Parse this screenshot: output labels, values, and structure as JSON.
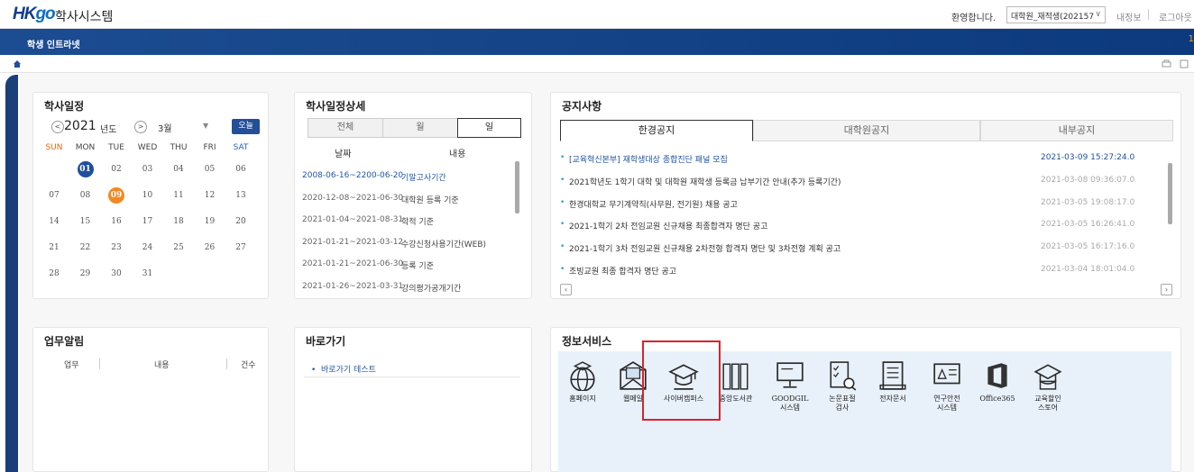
{
  "header": {
    "logo_main": "HK",
    "logo_accent": "go",
    "system_title": "학사시스템",
    "welcome": "환영합니다.",
    "user_select_value": "대학원_재적생(202157",
    "link_myinfo": "내정보",
    "link_logout": "로그아웃"
  },
  "navbar": {
    "title": "학생 인트라넷",
    "badge": "1"
  },
  "calendar": {
    "title": "학사일정",
    "year": "2021",
    "year_label": "년도",
    "month": "3월",
    "today_label": "오늘",
    "weekdays": [
      "SUN",
      "MON",
      "TUE",
      "WED",
      "THU",
      "FRI",
      "SAT"
    ],
    "weeks": [
      [
        "",
        "01",
        "02",
        "03",
        "04",
        "05",
        "06"
      ],
      [
        "07",
        "08",
        "09",
        "10",
        "11",
        "12",
        "13"
      ],
      [
        "14",
        "15",
        "16",
        "17",
        "18",
        "19",
        "20"
      ],
      [
        "21",
        "22",
        "23",
        "24",
        "25",
        "26",
        "27"
      ],
      [
        "28",
        "29",
        "30",
        "31",
        "",
        "",
        ""
      ]
    ],
    "selected_color": "#1f4f9e",
    "today_color": "#f08a24"
  },
  "schedule_detail": {
    "title": "학사일정상세",
    "tabs": [
      "전체",
      "월",
      "일"
    ],
    "col_date": "날짜",
    "col_content": "내용",
    "rows": [
      {
        "date": "2008-06-16~2200-06-20",
        "content": "기말고사기간"
      },
      {
        "date": "2020-12-08~2021-06-30",
        "content": "대학원 등록 기준"
      },
      {
        "date": "2021-01-04~2021-08-31",
        "content": "학적 기준"
      },
      {
        "date": "2021-01-21~2021-03-12",
        "content": "수강신청사용기간(WEB)"
      },
      {
        "date": "2021-01-21~2021-06-30",
        "content": "등록 기준"
      },
      {
        "date": "2021-01-26~2021-03-31",
        "content": "강의평가공개기간"
      }
    ]
  },
  "notices": {
    "title": "공지사항",
    "tabs": [
      "한경공지",
      "대학원공지",
      "내부공지"
    ],
    "rows": [
      {
        "title": "[교육혁신본부] 재학생대상 종합진단 패널 모집",
        "date": "2021-03-09 15:27:24.0"
      },
      {
        "title": "2021학년도 1학기 대학 및 대학원 재학생 등록금 납부기간 안내(추가 등록기간)",
        "date": "2021-03-08 09:36:07.0"
      },
      {
        "title": "한경대학교 무기계약직(사무원, 전기원) 채용 공고",
        "date": "2021-03-05 19:08:17.0"
      },
      {
        "title": " 2021-1학기 2차 전임교원 신규채용 최종합격자 명단 공고",
        "date": "2021-03-05 16:26:41.0"
      },
      {
        "title": "2021-1학기 3차 전임교원 신규채용 2차전형 합격자 명단 및 3차전형 계획 공고",
        "date": "2021-03-05 16:17:16.0"
      },
      {
        "title": "조빙교원 최종 합격자 명단 공고",
        "date": "2021-03-04 18:01:04.0"
      }
    ]
  },
  "work_alerts": {
    "title": "업무알림",
    "col_task": "업무",
    "col_content": "내용",
    "col_count": "건수"
  },
  "shortcuts": {
    "title": "바로가기",
    "items": [
      "바로가기 테스트"
    ]
  },
  "info_services": {
    "title": "정보서비스",
    "items": [
      {
        "label": "홈페이지",
        "icon": "globe-icon"
      },
      {
        "label": "웹메일",
        "icon": "mail-icon"
      },
      {
        "label": "사이버캠퍼스",
        "icon": "graduation-cap-icon"
      },
      {
        "label": "중앙도서관",
        "icon": "library-icon"
      },
      {
        "label": "GOODGIL\n시스템",
        "icon": "monitor-icon"
      },
      {
        "label": "논문표절\n검사",
        "icon": "checklist-search-icon"
      },
      {
        "label": "전자문서",
        "icon": "document-icon"
      },
      {
        "label": "연구안전\n시스템",
        "icon": "safety-board-icon"
      },
      {
        "label": "Office365",
        "icon": "office-icon"
      },
      {
        "label": "교육할인\n스토어",
        "icon": "store-icon"
      }
    ]
  }
}
